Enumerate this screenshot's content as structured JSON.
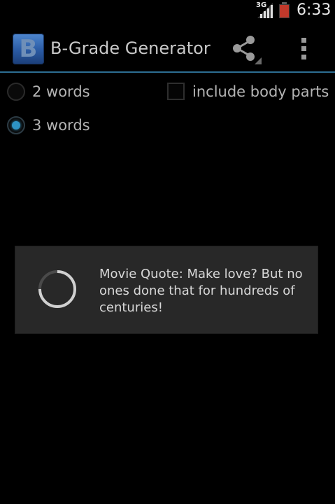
{
  "status_bar": {
    "network_type": "3G",
    "time": "6:33"
  },
  "action_bar": {
    "app_icon_letter": "B",
    "title": "B-Grade Generator",
    "share_icon": "share-icon",
    "overflow_icon": "overflow-menu-icon"
  },
  "options": {
    "word_count": [
      {
        "label": "2 words",
        "selected": false
      },
      {
        "label": "3 words",
        "selected": true
      }
    ],
    "body_parts": {
      "label": "include body parts",
      "checked": false
    }
  },
  "dialog": {
    "message": "Movie Quote:  Make love? But no ones done that for hundreds of centuries!"
  },
  "colors": {
    "accent": "#2e93c4",
    "divider": "#2d6e92",
    "dialog_bg": "#282828"
  }
}
